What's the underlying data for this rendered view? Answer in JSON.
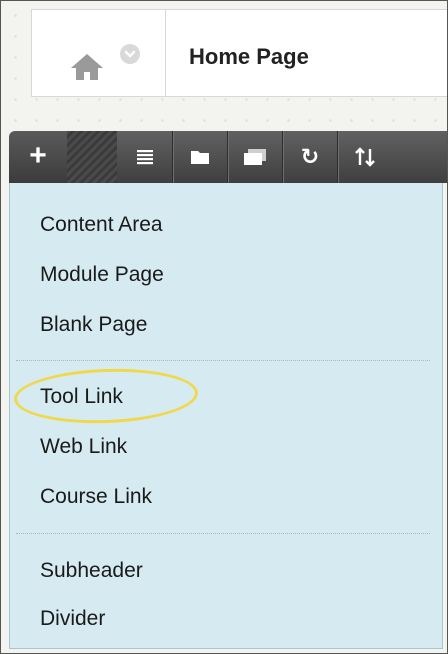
{
  "breadcrumb": {
    "home_icon": "home-icon",
    "menu_icon": "chevron-down-icon",
    "title": "Home Page"
  },
  "toolbar": {
    "add_label": "+",
    "buttons": [
      {
        "icon": "list-icon"
      },
      {
        "icon": "folder-icon"
      },
      {
        "icon": "window-icon"
      },
      {
        "icon": "refresh-icon"
      },
      {
        "icon": "sort-icon"
      }
    ]
  },
  "menu": {
    "groups": [
      [
        "Content Area",
        "Module Page",
        "Blank Page"
      ],
      [
        "Tool Link",
        "Web Link",
        "Course Link"
      ],
      [
        "Subheader",
        "Divider"
      ]
    ],
    "highlighted": "Tool Link"
  },
  "colors": {
    "menu_bg": "#d6ebf1",
    "toolbar_bg": "#4a4a4a",
    "highlight": "#f0d84c"
  }
}
